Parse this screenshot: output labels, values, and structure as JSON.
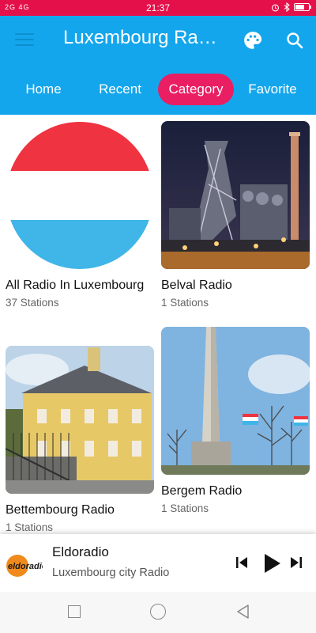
{
  "status_bar": {
    "network": "2G 4G",
    "time": "21:37",
    "battery_level": 0.7,
    "icons": [
      "alarm-icon",
      "bluetooth-icon",
      "battery-icon"
    ]
  },
  "app_bar": {
    "title": "Luxembourg Ra…",
    "icons": [
      "menu-icon",
      "palette-icon",
      "search-icon"
    ],
    "background_color": "#14a6ec"
  },
  "tabs": [
    {
      "label": "Home",
      "active": false
    },
    {
      "label": "Recent",
      "active": false
    },
    {
      "label": "Category",
      "active": true
    },
    {
      "label": "Favorite",
      "active": false
    }
  ],
  "accent_color": "#e91e63",
  "categories": [
    {
      "name": "All Radio In Luxembourg",
      "count": "37 Stations",
      "image": "luxembourg-flag"
    },
    {
      "name": "Belval Radio",
      "count": "1 Stations",
      "image": "belval-blast-furnace-night"
    },
    {
      "name": "Bettembourg Radio",
      "count": "1 Stations",
      "image": "bettembourg-castle"
    },
    {
      "name": "Bergem Radio",
      "count": "1 Stations",
      "image": "bergem-monument"
    }
  ],
  "player": {
    "logo_text": "eldoradio",
    "station": "Eldoradio",
    "subtitle": "Luxembourg city Radio",
    "controls": [
      "skip-previous-icon",
      "play-icon",
      "skip-next-icon"
    ]
  },
  "nav_bar": {
    "icons": [
      "recent-apps-icon",
      "home-icon",
      "back-icon"
    ]
  }
}
